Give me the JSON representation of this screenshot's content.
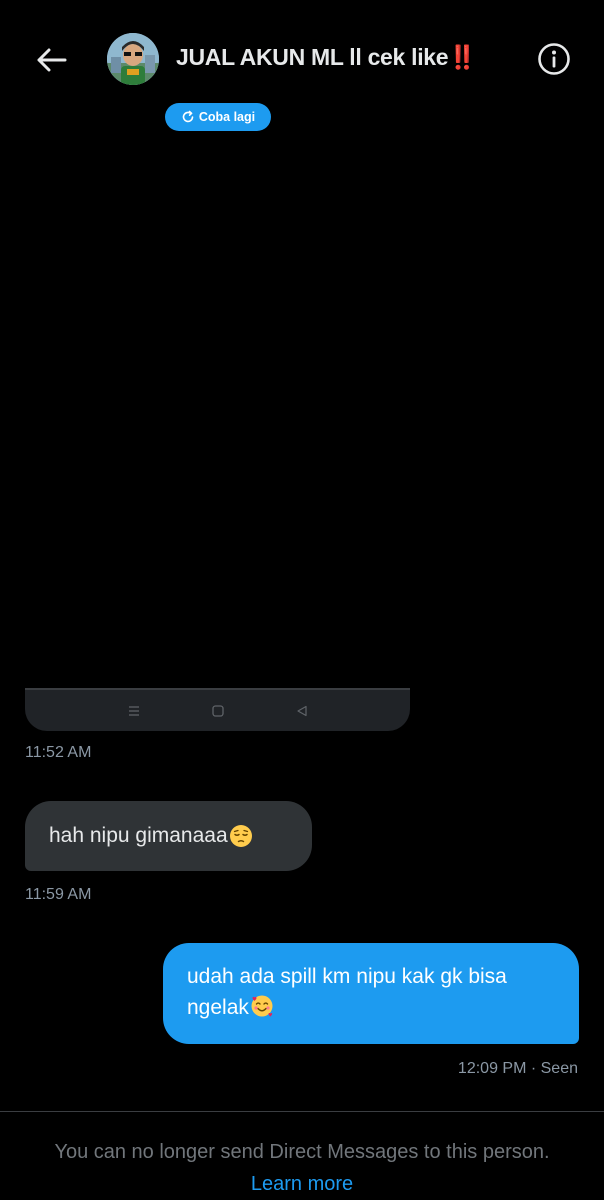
{
  "header": {
    "title": "JUAL AKUN ML ll cek like",
    "title_emoji": "‼️",
    "back_icon": "arrow-left-icon",
    "info_icon": "info-icon",
    "retry_label": "Coba lagi"
  },
  "messages": [
    {
      "direction": "received",
      "kind": "image",
      "time": "11:52 AM"
    },
    {
      "direction": "received",
      "text": "hah nipu gimanaaa",
      "emoji": "😔",
      "time": "11:59 AM"
    },
    {
      "direction": "sent",
      "text": "udah ada spill km nipu kak gk bisa ngelak",
      "emoji": "🥰",
      "time": "12:09 PM · Seen"
    }
  ],
  "footer": {
    "notice": "You can no longer send Direct Messages to this person.",
    "link": "Learn more"
  },
  "colors": {
    "background": "#000000",
    "accent": "#1d9bf0",
    "received_bubble": "#2f3336",
    "muted_text": "#8b98a5"
  }
}
